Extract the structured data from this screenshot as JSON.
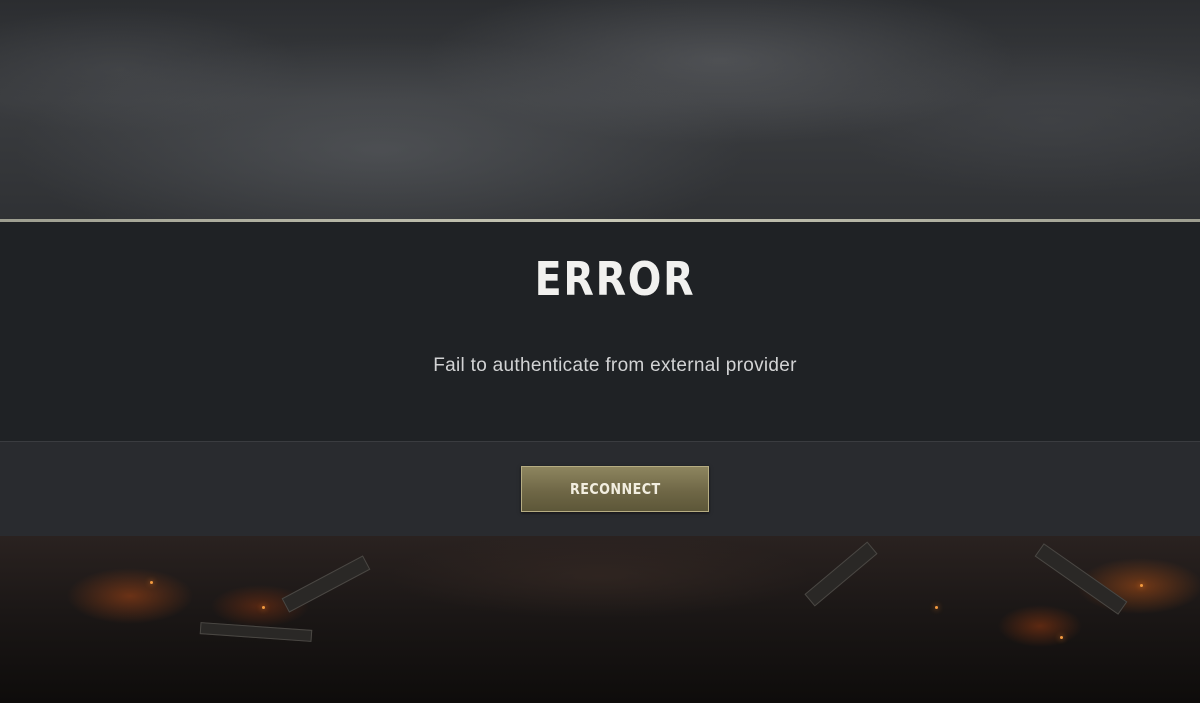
{
  "dialog": {
    "title": "ERROR",
    "message": "Fail to authenticate from external provider",
    "button_label": "RECONNECT"
  },
  "colors": {
    "dialog_background": "#1f2225",
    "footer_background": "#292b2f",
    "button_gold": "#7a7352",
    "divider": "#c8c8b6"
  }
}
